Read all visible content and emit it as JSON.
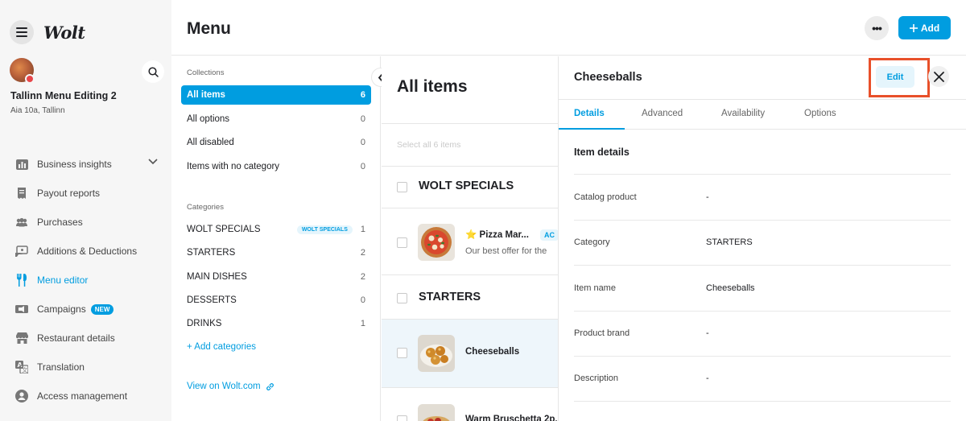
{
  "sidebar": {
    "logo": "Wolt",
    "venue_name": "Tallinn Menu Editing 2",
    "venue_address": "Aia 10a, Tallinn",
    "nav": [
      {
        "label": "Business insights",
        "icon": "bar-chart-icon"
      },
      {
        "label": "Payout reports",
        "icon": "receipt-icon"
      },
      {
        "label": "Purchases",
        "icon": "people-icon"
      },
      {
        "label": "Additions & Deductions",
        "icon": "money-icon"
      },
      {
        "label": "Menu editor",
        "icon": "fork-knife-icon",
        "active": true
      },
      {
        "label": "Campaigns",
        "icon": "megaphone-icon",
        "badge": "NEW"
      },
      {
        "label": "Restaurant details",
        "icon": "store-icon"
      },
      {
        "label": "Translation",
        "icon": "translate-icon"
      },
      {
        "label": "Access management",
        "icon": "user-circle-icon"
      }
    ]
  },
  "header": {
    "title": "Menu",
    "add_label": "Add",
    "more_label": "•••"
  },
  "collections": {
    "label": "Collections",
    "items": [
      {
        "label": "All items",
        "count": "6"
      },
      {
        "label": "All options",
        "count": "0"
      },
      {
        "label": "All disabled",
        "count": "0"
      },
      {
        "label": "Items with no category",
        "count": "0"
      }
    ],
    "categories_label": "Categories",
    "categories": [
      {
        "label": "WOLT SPECIALS",
        "badge": "WOLT SPECIALS",
        "count": "1"
      },
      {
        "label": "STARTERS",
        "count": "2"
      },
      {
        "label": "MAIN DISHES",
        "count": "2"
      },
      {
        "label": "DESSERTS",
        "count": "0"
      },
      {
        "label": "DRINKS",
        "count": "1"
      }
    ],
    "add_categories": "+ Add categories",
    "view_on_wolt": "View on Wolt.com"
  },
  "items_panel": {
    "title": "All items",
    "select_all": "Select all 6 items",
    "sections": [
      {
        "heading": "WOLT SPECIALS"
      },
      {
        "heading": "STARTERS"
      }
    ],
    "items": [
      {
        "name": "Pizza Mar...",
        "prefix": "⭐",
        "description": "Our best offer for the",
        "badge": "AC"
      },
      {
        "name": "Cheeseballs",
        "description": ""
      },
      {
        "name": "Warm Bruschetta 2p..."
      }
    ]
  },
  "detail": {
    "title": "Cheeseballs",
    "edit_label": "Edit",
    "tabs": [
      "Details",
      "Advanced",
      "Availability",
      "Options"
    ],
    "section_title": "Item details",
    "fields": [
      {
        "label": "Catalog product",
        "value": "-"
      },
      {
        "label": "Category",
        "value": "STARTERS"
      },
      {
        "label": "Item name",
        "value": "Cheeseballs"
      },
      {
        "label": "Product brand",
        "value": "-"
      },
      {
        "label": "Description",
        "value": "-"
      }
    ]
  },
  "colors": {
    "accent": "#009de0",
    "highlight_box": "#e8502a"
  }
}
